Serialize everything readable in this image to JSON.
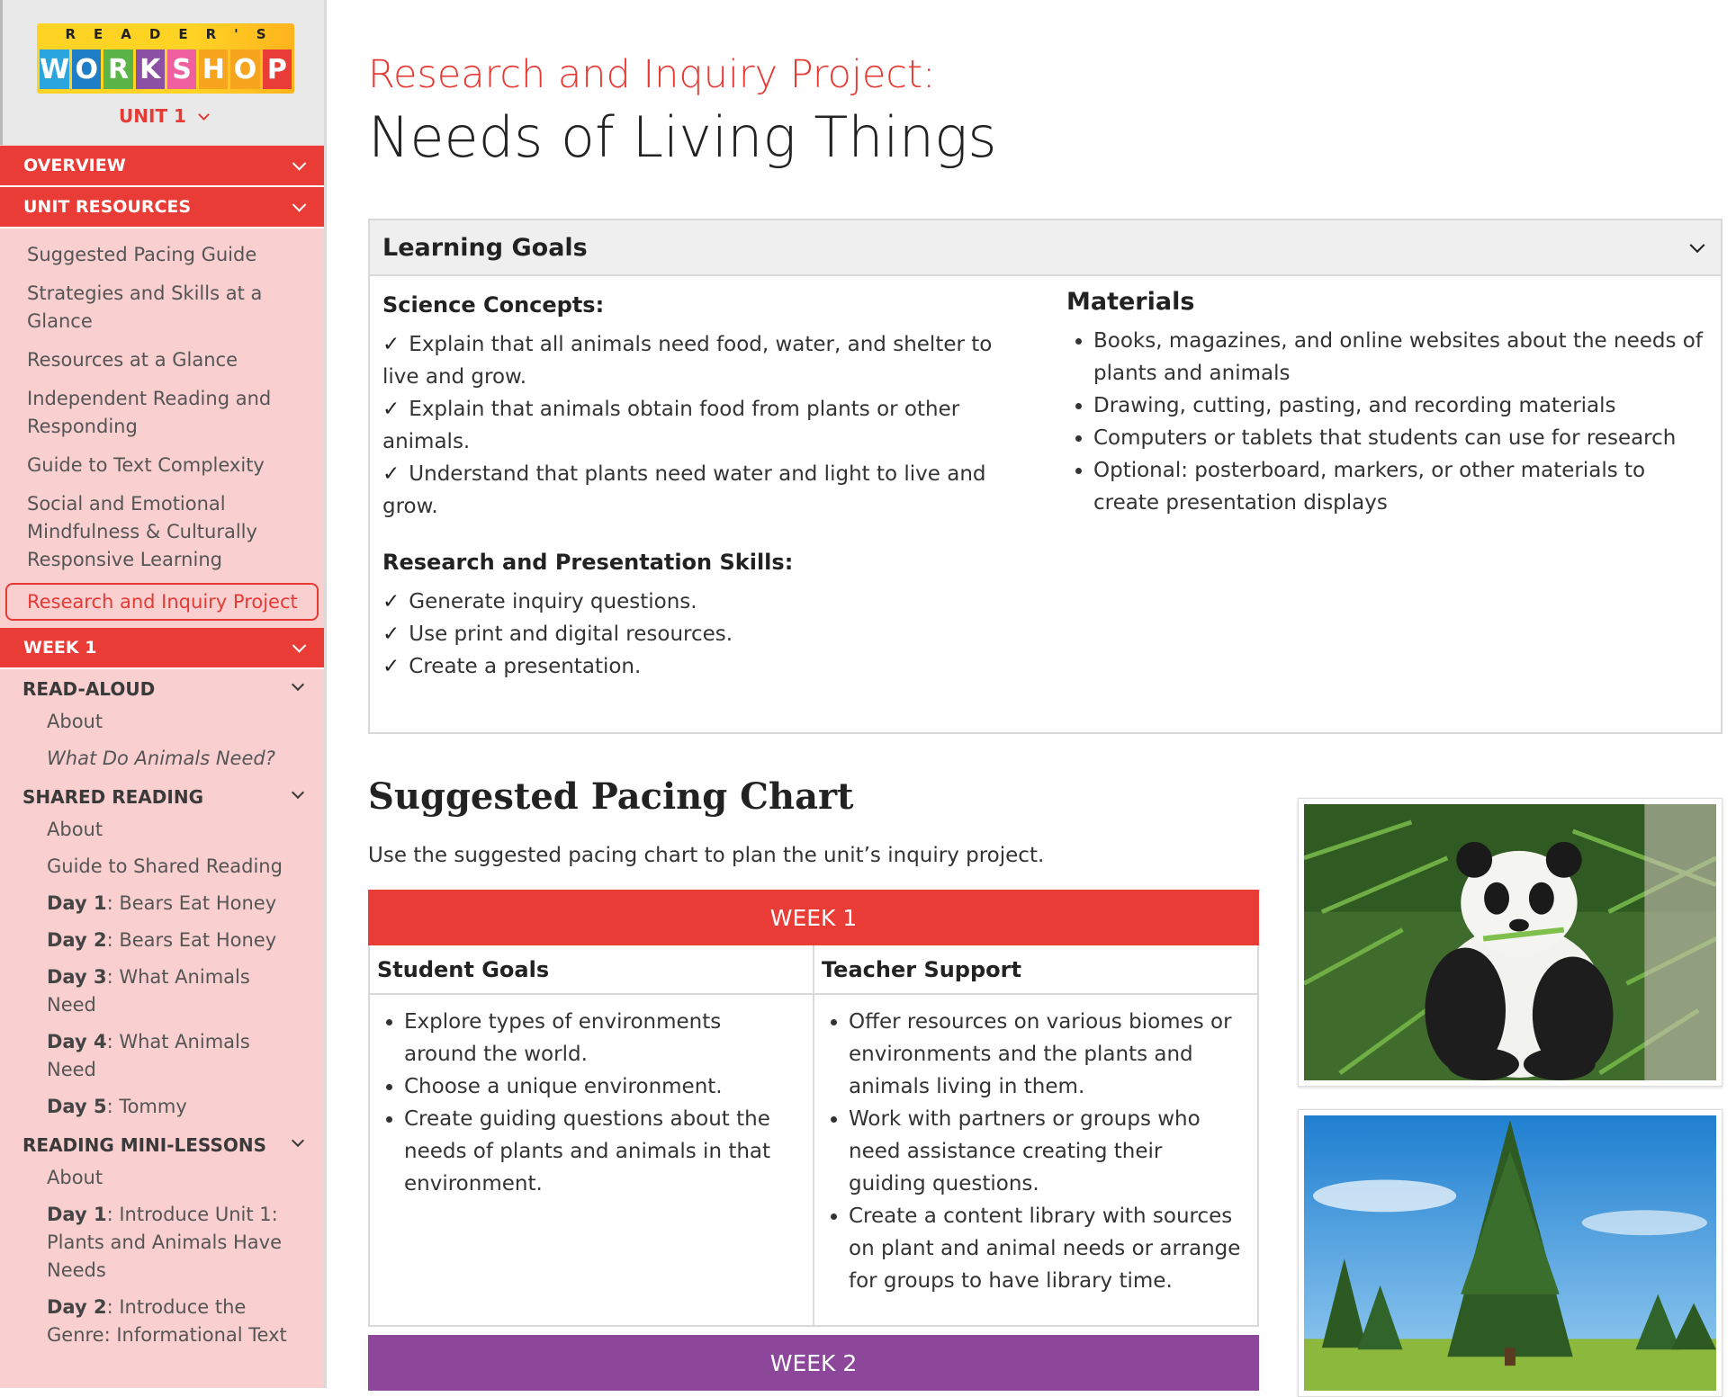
{
  "brand": {
    "logo_top": "READER'S",
    "logo_letters": [
      "W",
      "O",
      "R",
      "K",
      "S",
      "H",
      "O",
      "P"
    ],
    "logo_colors": [
      "#2aa5e0",
      "#1e7fc7",
      "#5bb447",
      "#8b4fa3",
      "#f0609e",
      "#f7a51f",
      "#f7a51f",
      "#ea3c36"
    ],
    "unit_label": "UNIT 1"
  },
  "sidebar": {
    "overview": "OVERVIEW",
    "unit_resources": "UNIT RESOURCES",
    "resource_links": [
      "Suggested Pacing Guide",
      "Strategies and Skills at a Glance",
      "Resources at a Glance",
      "Independent Reading and Responding",
      "Guide to Text Complexity",
      "Social and Emotional Mindfulness & Culturally Responsive Learning"
    ],
    "active_link": "Research and Inquiry Project",
    "week1": "WEEK 1",
    "read_aloud": {
      "title": "READ-ALOUD",
      "items": [
        "About",
        "What Do Animals Need?"
      ]
    },
    "shared_reading": {
      "title": "SHARED READING",
      "about": "About",
      "guide": "Guide to Shared Reading",
      "days": [
        {
          "day": "Day 1",
          "text": ": Bears Eat Honey"
        },
        {
          "day": "Day 2",
          "text": ": Bears Eat Honey"
        },
        {
          "day": "Day 3",
          "text": ": What Animals Need"
        },
        {
          "day": "Day 4",
          "text": ": What Animals Need"
        },
        {
          "day": "Day 5",
          "text": ": Tommy"
        }
      ]
    },
    "mini_lessons": {
      "title": "READING MINI-LESSONS",
      "about": "About",
      "days": [
        {
          "day": "Day 1",
          "text": ": Introduce Unit 1: Plants and Animals Have Needs"
        },
        {
          "day": "Day 2",
          "text": ": Introduce the Genre: Informational Text"
        }
      ]
    }
  },
  "page": {
    "kicker": "Research and Inquiry Project:",
    "title": "Needs of Living Things"
  },
  "learning_goals": {
    "header": "Learning Goals",
    "science_heading": "Science Concepts:",
    "science_items": [
      "Explain that all animals need food, water, and shelter to live and grow.",
      "Explain that animals obtain food from plants or other animals.",
      "Understand that plants need water and light to live and grow."
    ],
    "skills_heading": "Research and Presentation Skills:",
    "skills_items": [
      "Generate inquiry questions.",
      "Use print and digital resources.",
      "Create a presentation."
    ],
    "check_mark": "✓",
    "materials_heading": "Materials",
    "materials_items": [
      "Books, magazines, and online websites about the needs of plants and animals",
      "Drawing, cutting, pasting, and recording materials",
      "Computers or tablets that students can use for research",
      "Optional: posterboard, markers, or other materials to create presentation displays"
    ]
  },
  "pacing": {
    "title": "Suggested Pacing Chart",
    "intro": "Use the suggested pacing chart to plan the unit’s inquiry project.",
    "week1_label": "WEEK 1",
    "week2_label": "WEEK 2",
    "col_student": "Student Goals",
    "col_teacher": "Teacher Support",
    "student_goals": [
      "Explore types of environments around the world.",
      "Choose a unique environment.",
      "Create guiding questions about the needs of plants and animals in that environment."
    ],
    "teacher_support": [
      "Offer resources on various biomes or environments and the plants and animals living in them.",
      "Work with partners or groups who need assistance creating their guiding questions.",
      "Create a content library with sources on plant and animal needs or arrange for groups to have library time."
    ]
  },
  "colors": {
    "accent_red": "#ea3c36",
    "week2_purple": "#8c479a",
    "sidebar_bg": "#f9cfcf"
  }
}
